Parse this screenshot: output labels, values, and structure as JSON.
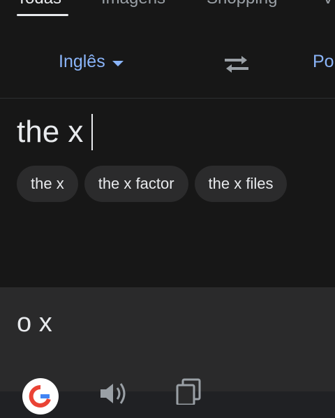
{
  "tabs": [
    {
      "label": "Todas",
      "active": true
    },
    {
      "label": "Imagens",
      "active": false
    },
    {
      "label": "Shopping",
      "active": false
    },
    {
      "label": "V",
      "active": false
    }
  ],
  "languages": {
    "source": "Inglês",
    "target": "Po"
  },
  "source_input": {
    "value": "the x"
  },
  "suggestions": [
    "the x",
    "the x factor",
    "the x files"
  ],
  "translation": {
    "text": "o x"
  },
  "icons": {
    "swap": "swap-arrows-icon",
    "dropdown": "chevron-down-icon",
    "google": "google-logo-icon",
    "speaker": "speaker-icon",
    "copy": "copy-icon"
  },
  "colors": {
    "accent": "#8ab4f8",
    "background": "#171717",
    "result_background": "#2a2a2b",
    "chip_background": "#2b2b2c"
  }
}
